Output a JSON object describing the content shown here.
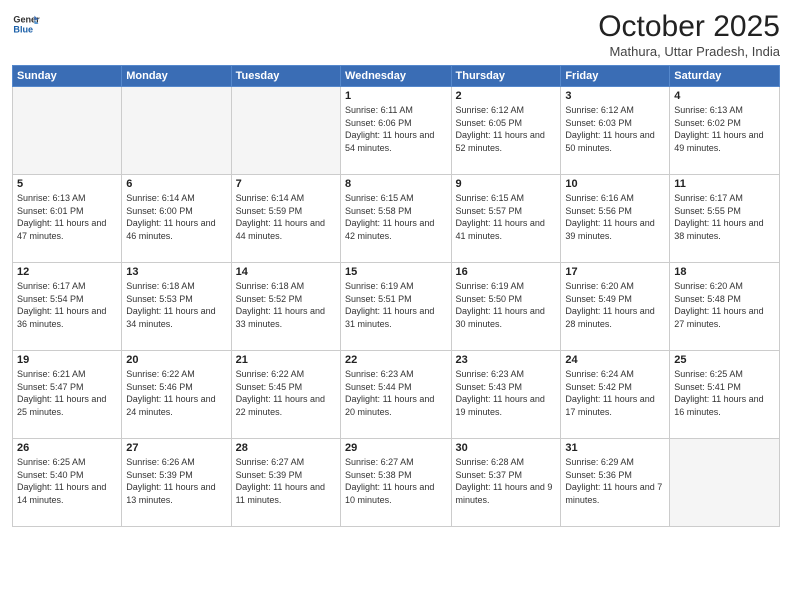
{
  "header": {
    "logo_general": "General",
    "logo_blue": "Blue",
    "month_title": "October 2025",
    "location": "Mathura, Uttar Pradesh, India"
  },
  "days_of_week": [
    "Sunday",
    "Monday",
    "Tuesday",
    "Wednesday",
    "Thursday",
    "Friday",
    "Saturday"
  ],
  "weeks": [
    [
      {
        "day": "",
        "empty": true
      },
      {
        "day": "",
        "empty": true
      },
      {
        "day": "",
        "empty": true
      },
      {
        "day": "1",
        "sunrise": "6:11 AM",
        "sunset": "6:06 PM",
        "daylight": "11 hours and 54 minutes."
      },
      {
        "day": "2",
        "sunrise": "6:12 AM",
        "sunset": "6:05 PM",
        "daylight": "11 hours and 52 minutes."
      },
      {
        "day": "3",
        "sunrise": "6:12 AM",
        "sunset": "6:03 PM",
        "daylight": "11 hours and 50 minutes."
      },
      {
        "day": "4",
        "sunrise": "6:13 AM",
        "sunset": "6:02 PM",
        "daylight": "11 hours and 49 minutes."
      }
    ],
    [
      {
        "day": "5",
        "sunrise": "6:13 AM",
        "sunset": "6:01 PM",
        "daylight": "11 hours and 47 minutes."
      },
      {
        "day": "6",
        "sunrise": "6:14 AM",
        "sunset": "6:00 PM",
        "daylight": "11 hours and 46 minutes."
      },
      {
        "day": "7",
        "sunrise": "6:14 AM",
        "sunset": "5:59 PM",
        "daylight": "11 hours and 44 minutes."
      },
      {
        "day": "8",
        "sunrise": "6:15 AM",
        "sunset": "5:58 PM",
        "daylight": "11 hours and 42 minutes."
      },
      {
        "day": "9",
        "sunrise": "6:15 AM",
        "sunset": "5:57 PM",
        "daylight": "11 hours and 41 minutes."
      },
      {
        "day": "10",
        "sunrise": "6:16 AM",
        "sunset": "5:56 PM",
        "daylight": "11 hours and 39 minutes."
      },
      {
        "day": "11",
        "sunrise": "6:17 AM",
        "sunset": "5:55 PM",
        "daylight": "11 hours and 38 minutes."
      }
    ],
    [
      {
        "day": "12",
        "sunrise": "6:17 AM",
        "sunset": "5:54 PM",
        "daylight": "11 hours and 36 minutes."
      },
      {
        "day": "13",
        "sunrise": "6:18 AM",
        "sunset": "5:53 PM",
        "daylight": "11 hours and 34 minutes."
      },
      {
        "day": "14",
        "sunrise": "6:18 AM",
        "sunset": "5:52 PM",
        "daylight": "11 hours and 33 minutes."
      },
      {
        "day": "15",
        "sunrise": "6:19 AM",
        "sunset": "5:51 PM",
        "daylight": "11 hours and 31 minutes."
      },
      {
        "day": "16",
        "sunrise": "6:19 AM",
        "sunset": "5:50 PM",
        "daylight": "11 hours and 30 minutes."
      },
      {
        "day": "17",
        "sunrise": "6:20 AM",
        "sunset": "5:49 PM",
        "daylight": "11 hours and 28 minutes."
      },
      {
        "day": "18",
        "sunrise": "6:20 AM",
        "sunset": "5:48 PM",
        "daylight": "11 hours and 27 minutes."
      }
    ],
    [
      {
        "day": "19",
        "sunrise": "6:21 AM",
        "sunset": "5:47 PM",
        "daylight": "11 hours and 25 minutes."
      },
      {
        "day": "20",
        "sunrise": "6:22 AM",
        "sunset": "5:46 PM",
        "daylight": "11 hours and 24 minutes."
      },
      {
        "day": "21",
        "sunrise": "6:22 AM",
        "sunset": "5:45 PM",
        "daylight": "11 hours and 22 minutes."
      },
      {
        "day": "22",
        "sunrise": "6:23 AM",
        "sunset": "5:44 PM",
        "daylight": "11 hours and 20 minutes."
      },
      {
        "day": "23",
        "sunrise": "6:23 AM",
        "sunset": "5:43 PM",
        "daylight": "11 hours and 19 minutes."
      },
      {
        "day": "24",
        "sunrise": "6:24 AM",
        "sunset": "5:42 PM",
        "daylight": "11 hours and 17 minutes."
      },
      {
        "day": "25",
        "sunrise": "6:25 AM",
        "sunset": "5:41 PM",
        "daylight": "11 hours and 16 minutes."
      }
    ],
    [
      {
        "day": "26",
        "sunrise": "6:25 AM",
        "sunset": "5:40 PM",
        "daylight": "11 hours and 14 minutes."
      },
      {
        "day": "27",
        "sunrise": "6:26 AM",
        "sunset": "5:39 PM",
        "daylight": "11 hours and 13 minutes."
      },
      {
        "day": "28",
        "sunrise": "6:27 AM",
        "sunset": "5:39 PM",
        "daylight": "11 hours and 11 minutes."
      },
      {
        "day": "29",
        "sunrise": "6:27 AM",
        "sunset": "5:38 PM",
        "daylight": "11 hours and 10 minutes."
      },
      {
        "day": "30",
        "sunrise": "6:28 AM",
        "sunset": "5:37 PM",
        "daylight": "11 hours and 9 minutes."
      },
      {
        "day": "31",
        "sunrise": "6:29 AM",
        "sunset": "5:36 PM",
        "daylight": "11 hours and 7 minutes."
      },
      {
        "day": "",
        "empty": true
      }
    ]
  ]
}
